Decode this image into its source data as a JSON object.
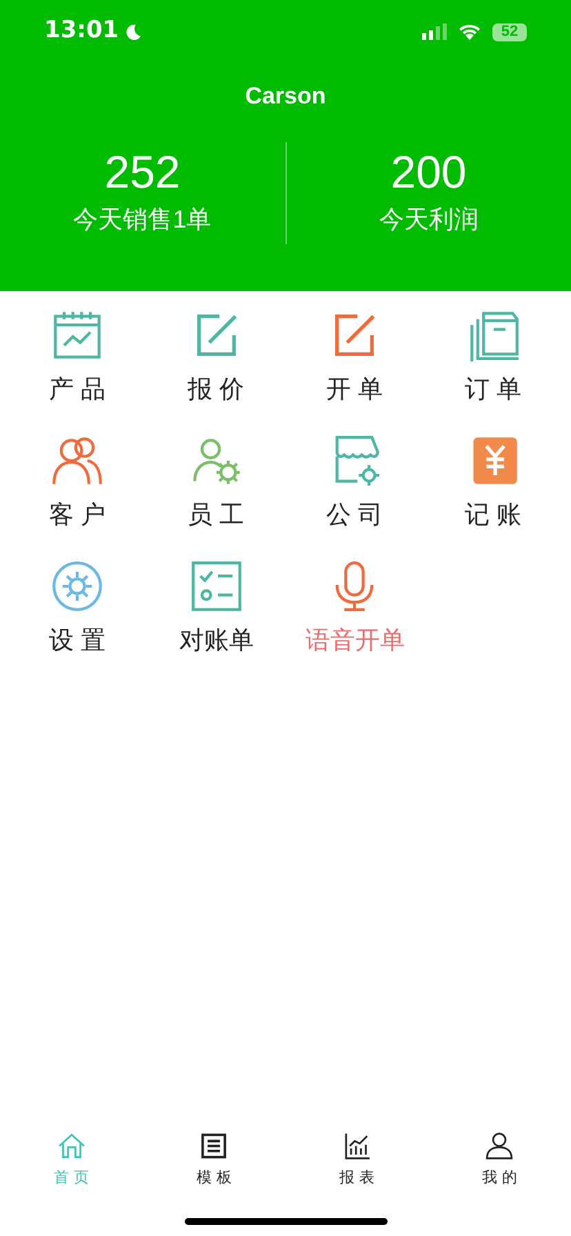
{
  "status_bar": {
    "time": "13:01",
    "battery": "52"
  },
  "header": {
    "title": "Carson"
  },
  "stats": [
    {
      "value": "252",
      "label": "今天销售1单"
    },
    {
      "value": "200",
      "label": "今天利润"
    }
  ],
  "menu": [
    {
      "label": "产 品",
      "color": "#222222"
    },
    {
      "label": "报 价",
      "color": "#222222"
    },
    {
      "label": "开 单",
      "color": "#222222"
    },
    {
      "label": "订 单",
      "color": "#222222"
    },
    {
      "label": "客 户",
      "color": "#222222"
    },
    {
      "label": "员 工",
      "color": "#222222"
    },
    {
      "label": "公 司",
      "color": "#222222"
    },
    {
      "label": "记 账",
      "color": "#222222"
    },
    {
      "label": "设 置",
      "color": "#222222"
    },
    {
      "label": "对账单",
      "color": "#222222"
    },
    {
      "label": "语音开单",
      "color": "#f06a6a"
    }
  ],
  "tab_bar": [
    {
      "label": "首 页",
      "selected": true
    },
    {
      "label": "模 板",
      "selected": false
    },
    {
      "label": "报 表",
      "selected": false
    },
    {
      "label": "我 的",
      "selected": false
    }
  ]
}
